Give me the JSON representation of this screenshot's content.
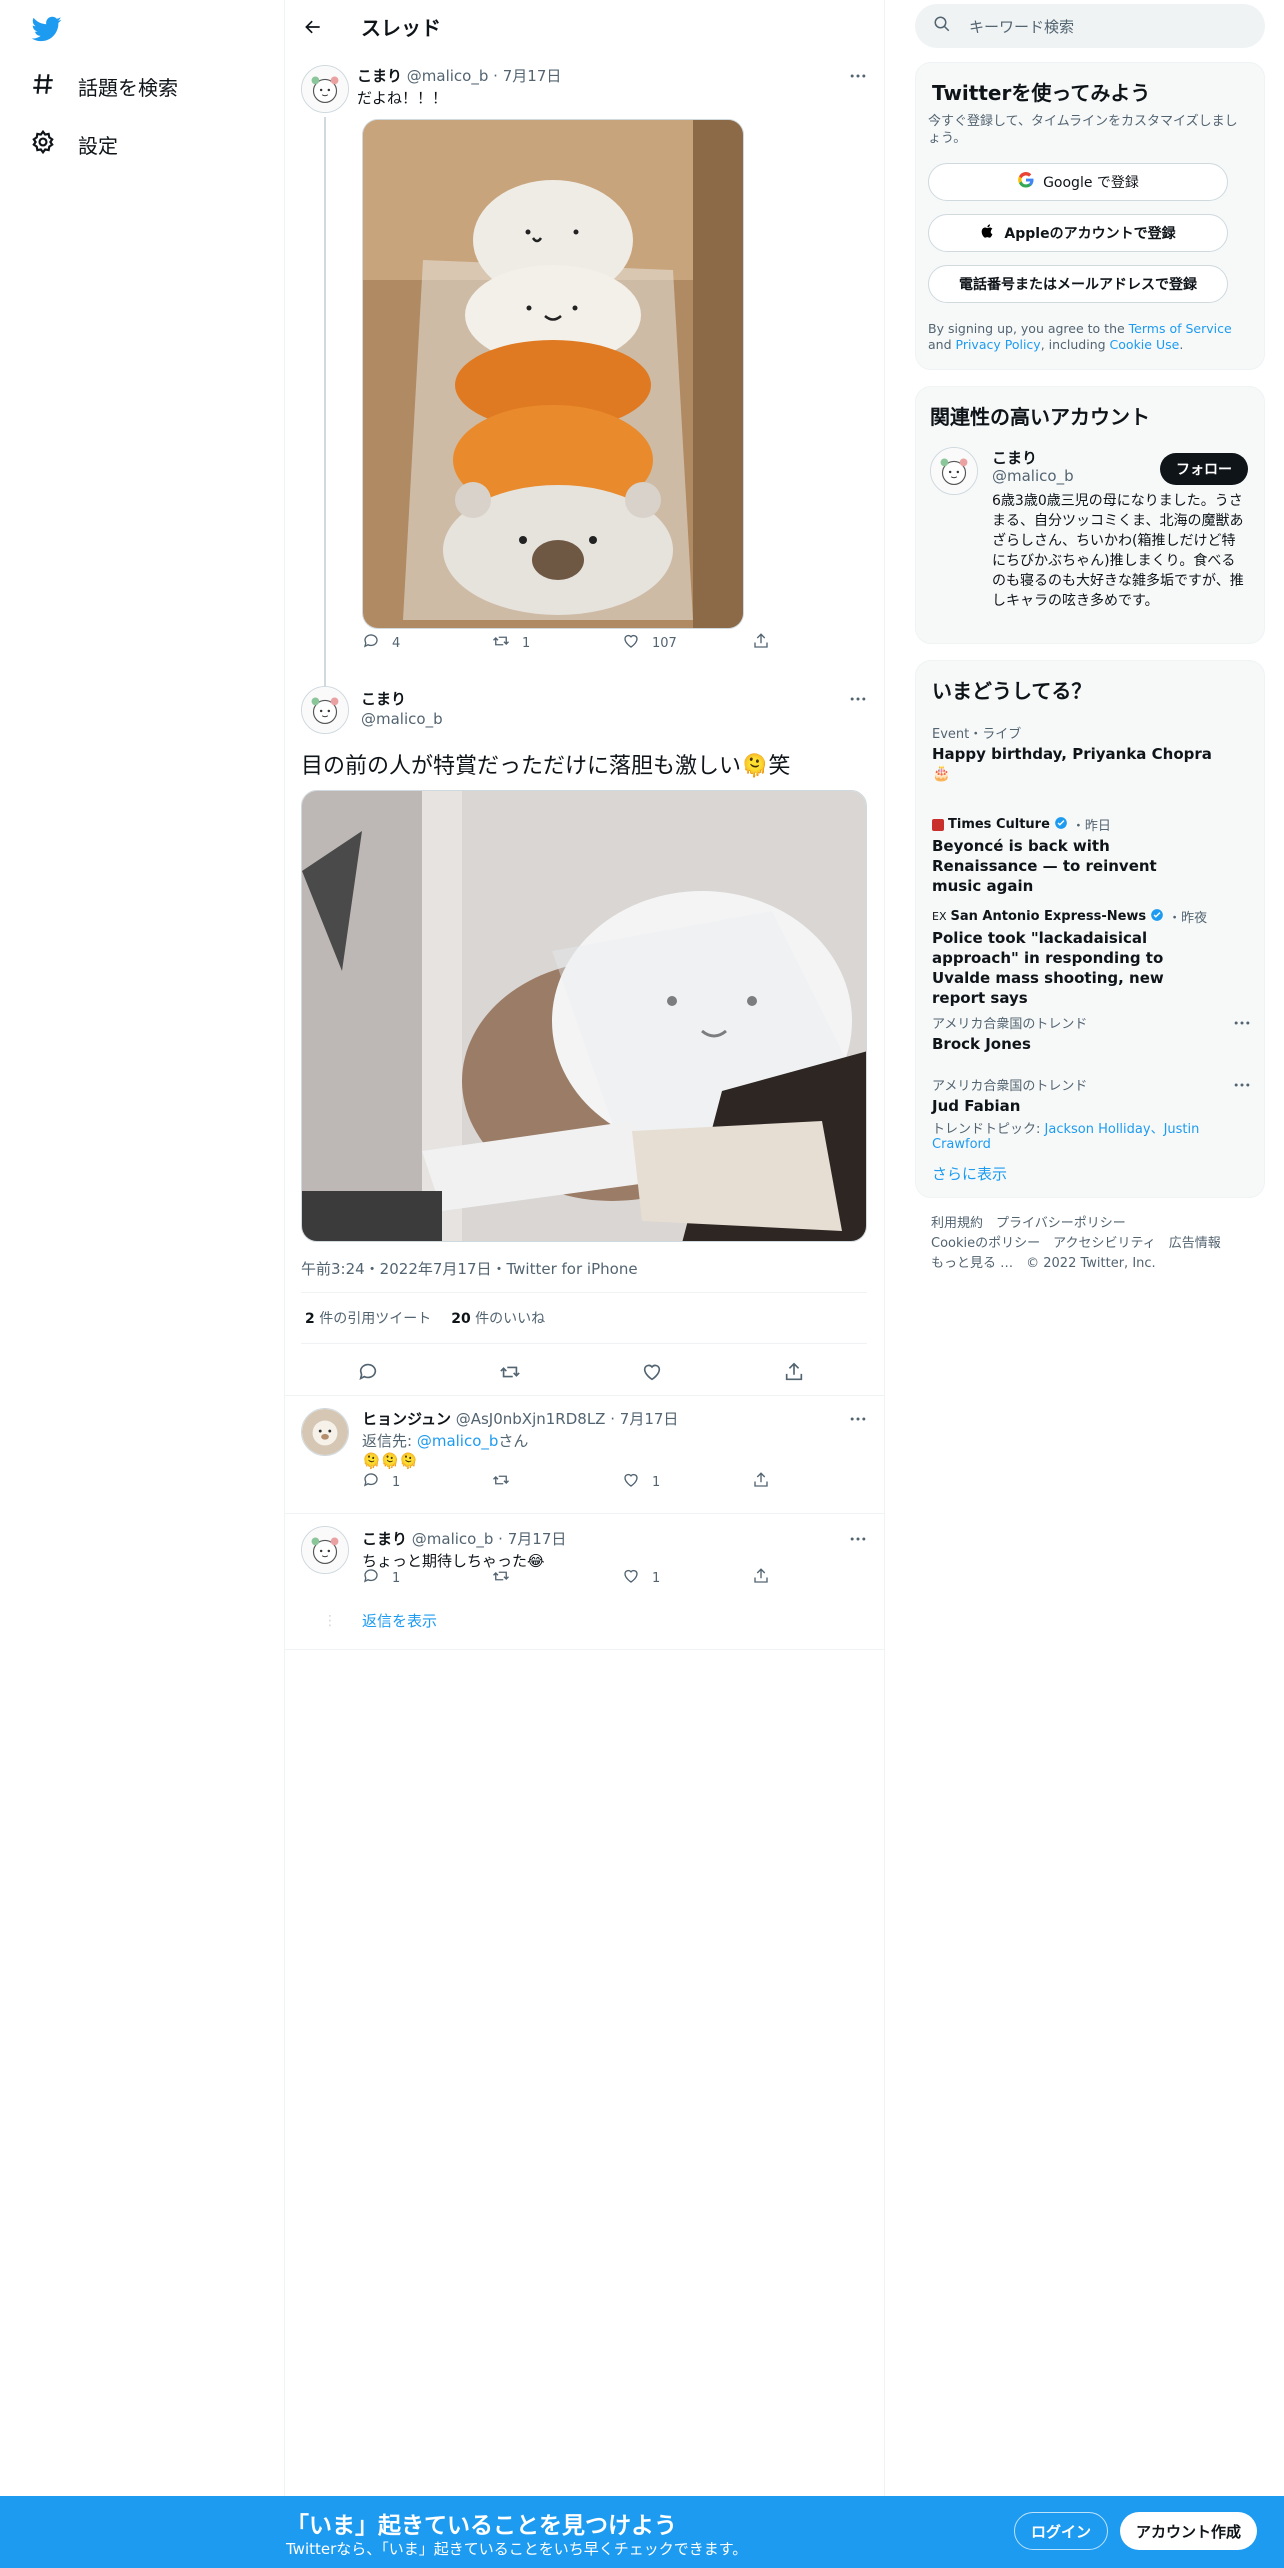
{
  "nav": {
    "explore_label": "話題を検索",
    "settings_label": "設定"
  },
  "header": {
    "title": "スレッド"
  },
  "tweet1": {
    "name": "こまり",
    "handle": "@malico_b",
    "date": "7月17日",
    "text": "だよね！！！",
    "replies": "4",
    "retweets": "1",
    "likes": "107"
  },
  "main_tweet": {
    "name": "こまり",
    "handle": "@malico_b",
    "text": "目の前の人が特賞だっただけに落胆も激しい🫠笑",
    "meta": "午前3:24・2022年7月17日・Twitter for iPhone",
    "quote_count": "2",
    "quote_label": "件の引用ツイート",
    "like_count": "20",
    "like_label": "件のいいね"
  },
  "reply1": {
    "name": "ヒョンジュン",
    "handle": "@AsJ0nbXjn1RD8LZ",
    "date": "7月17日",
    "reply_to_prefix": "返信先: ",
    "reply_to_handle": "@malico_b",
    "reply_to_suffix": "さん",
    "text": "🫠🫠🫠",
    "replies": "1",
    "likes": "1"
  },
  "reply2": {
    "name": "こまり",
    "handle": "@malico_b",
    "date": "7月17日",
    "text": "ちょっと期待しちゃった😂",
    "replies": "1",
    "likes": "1",
    "show_replies": "返信を表示"
  },
  "search": {
    "placeholder": "キーワード検索"
  },
  "signup_card": {
    "title": "Twitterを使ってみよう",
    "subtitle": "今すぐ登録して、タイムラインをカスタマイズしましょう。",
    "google_label": "Google で登録",
    "apple_label": "Appleのアカウントで登録",
    "phone_label": "電話番号またはメールアドレスで登録",
    "legal_pre": "By signing up, you agree to the ",
    "terms": "Terms of Service",
    "legal_and": " and ",
    "privacy": "Privacy Policy",
    "legal_mid": ", including ",
    "cookie": "Cookie Use",
    "legal_end": "."
  },
  "related": {
    "title": "関連性の高いアカウント",
    "name": "こまり",
    "handle": "@malico_b",
    "follow": "フォロー",
    "bio": "6歳3歳0歳三児の母になりました。うさまる、自分ツッコミくま、北海の魔獣あざらしさん、ちいかわ(箱推しだけど特にちびかぶちゃん)推しまくり。食べるのも寝るのも大好きな雑多垢ですが、推しキャラの呟き多めです。"
  },
  "trends": {
    "title": "いまどうしてる？",
    "items": [
      {
        "context": "Event・ライブ",
        "title": "Happy birthday, Priyanka Chopra",
        "emoji": "🎂"
      },
      {
        "source": "Times Culture",
        "time": "・昨日",
        "title": "Beyoncé is back with Renaissance — to reinvent music again"
      },
      {
        "source": "San Antonio Express-News",
        "time": "・昨夜",
        "title": "Police took \"lackadaisical approach\" in responding to Uvalde mass shooting, new report says"
      },
      {
        "context": "アメリカ合衆国のトレンド",
        "title": "Brock Jones"
      },
      {
        "context": "アメリカ合衆国のトレンド",
        "title": "Jud Fabian",
        "topic_label": "トレンドトピック: ",
        "topics": "Jackson Holliday、Justin Crawford"
      }
    ],
    "show_more": "さらに表示"
  },
  "footer": {
    "line1": "利用規約　プライバシーポリシー",
    "line2": "Cookieのポリシー　アクセシビリティ　広告情報",
    "line3": "もっと見る …　© 2022 Twitter, Inc."
  },
  "bottom_bar": {
    "title": "「いま」起きていることを見つけよう",
    "subtitle": "Twitterなら、「いま」起きていることをいち早くチェックできます。",
    "login": "ログイン",
    "signup": "アカウント作成"
  },
  "colors": {
    "accent": "#1d9bf0",
    "text": "#0f1419",
    "muted": "#536471"
  }
}
